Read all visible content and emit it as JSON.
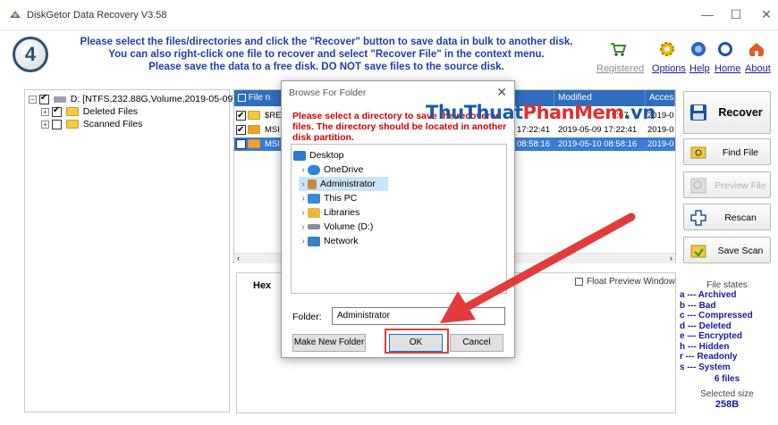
{
  "window": {
    "title": "DiskGetor Data Recovery V3.58"
  },
  "header": {
    "step": "4",
    "instructions": [
      "Please select the files/directories and click the \"Recover\" button to save data in bulk to another disk.",
      "You can also right-click one file to recover and select \"Recover File\" in the context menu.",
      "Please save the data to a free disk. DO NOT save files to the source disk."
    ],
    "links": {
      "registered": "Registered",
      "options": "Options",
      "help": "Help",
      "home": "Home",
      "about": "About"
    }
  },
  "tree": {
    "root": "D: [NTFS,232.88G,Volume,2019-05-09]",
    "children": [
      "Deleted Files",
      "Scanned Files"
    ]
  },
  "files": {
    "columns": [
      "File n",
      "Modified",
      "Accesse"
    ],
    "rows": [
      {
        "name": "$REC",
        "modified_partial": "5:07",
        "accessed": "2019-0",
        "checked": true,
        "selected": false
      },
      {
        "name": "MSI",
        "modified_partial": "17:22:41",
        "modified": "2019-05-09 17:22:41",
        "accessed": "2019-0",
        "checked": true,
        "selected": false
      },
      {
        "name": "MSI",
        "modified_partial": "08:58:16",
        "modified": "2019-05-10 08:58:16",
        "accessed": "2019-0",
        "checked": false,
        "selected": true
      }
    ]
  },
  "preview": {
    "hex_label": "Hex",
    "float_preview": "Float Preview Window"
  },
  "sidebar": {
    "recover": "Recover",
    "find_file": "Find File",
    "preview_file": "Preview File",
    "rescan": "Rescan",
    "save_scan": "Save Scan"
  },
  "file_states": {
    "title": "File states",
    "items": [
      "a --- Archived",
      "b --- Bad",
      "c --- Compressed",
      "d --- Deleted",
      "e --- Encrypted",
      "h --- Hidden",
      "r --- Readonly",
      "s --- System"
    ],
    "count": "6 files",
    "selected_size_label": "Selected size",
    "selected_size": "258B"
  },
  "dialog": {
    "title": "Browse For Folder",
    "message": "Please select a directory to save the recovered files. The directory should be located in another disk partition.",
    "tree": [
      "Desktop",
      "OneDrive",
      "Administrator",
      "This PC",
      "Libraries",
      "Volume (D:)",
      "Network"
    ],
    "folder_label": "Folder:",
    "folder_value": "Administrator",
    "make_new_folder": "Make New Folder",
    "ok": "OK",
    "cancel": "Cancel"
  },
  "watermark": {
    "part1": "ThuThuat",
    "part2": "PhanMem",
    "part3": ".vn"
  },
  "colors": {
    "header_text": "#1f3fa0",
    "table_header": "#2f6dbd",
    "selection": "#3a7bd5",
    "arrow": "#e23b3b",
    "dialog_message": "#d00000"
  }
}
